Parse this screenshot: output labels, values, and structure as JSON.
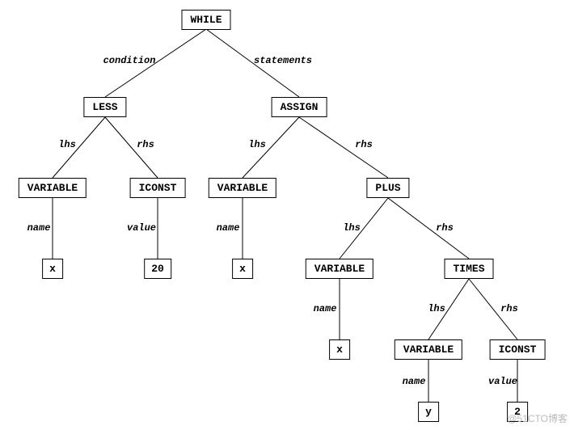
{
  "tree": {
    "root": {
      "label": "WHILE"
    },
    "edges": {
      "root_left": "condition",
      "root_right": "statements",
      "less_lhs": "lhs",
      "less_rhs": "rhs",
      "assign_lhs": "lhs",
      "assign_rhs": "rhs",
      "var1_name": "name",
      "iconst1_value": "value",
      "var2_name": "name",
      "plus_lhs": "lhs",
      "plus_rhs": "rhs",
      "var3_name": "name",
      "times_lhs": "lhs",
      "times_rhs": "rhs",
      "var4_name": "name",
      "iconst2_value": "value"
    },
    "nodes": {
      "less": "LESS",
      "assign": "ASSIGN",
      "var1": "VARIABLE",
      "iconst1": "ICONST",
      "var2": "VARIABLE",
      "plus": "PLUS",
      "var3": "VARIABLE",
      "times": "TIMES",
      "var4": "VARIABLE",
      "iconst2": "ICONST"
    },
    "leaves": {
      "x1": "x",
      "v20": "20",
      "x2": "x",
      "x3": "x",
      "y": "y",
      "v2": "2"
    }
  },
  "watermark": "@51CTO博客"
}
